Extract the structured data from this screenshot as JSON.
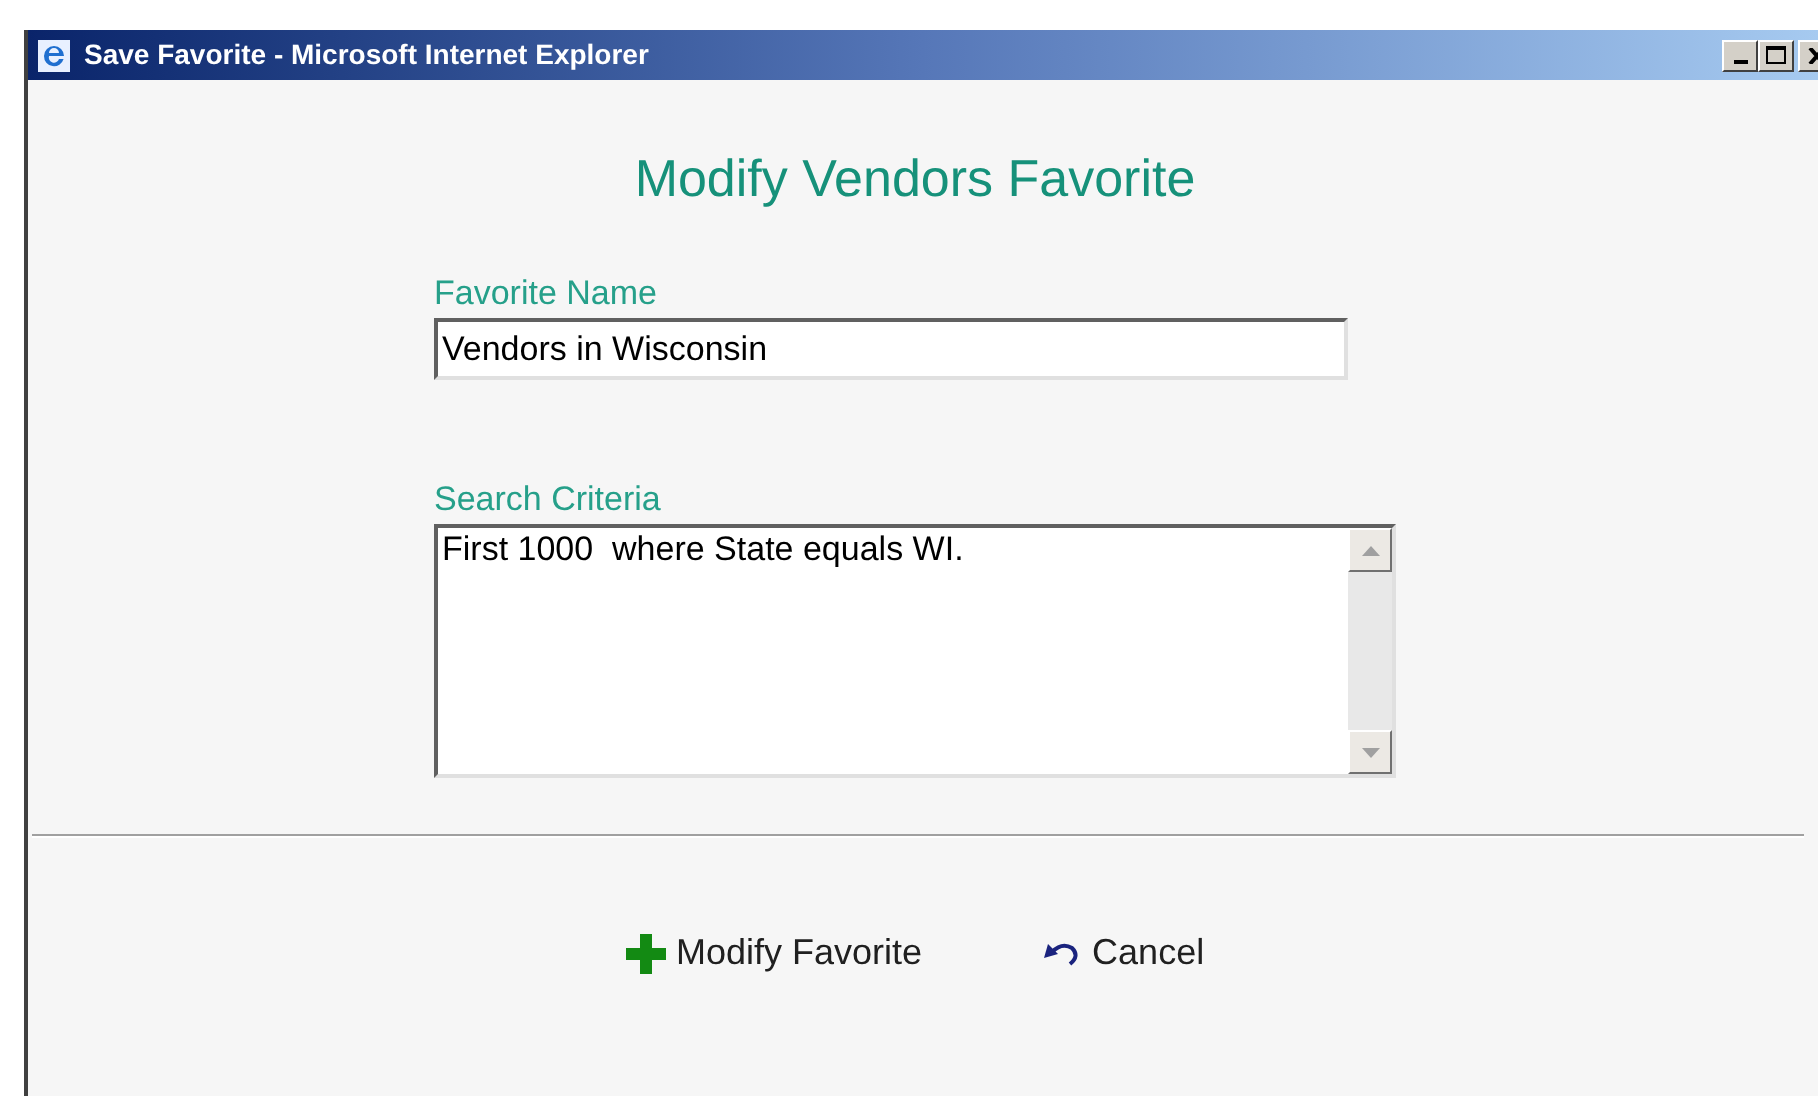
{
  "window": {
    "title": "Save Favorite - Microsoft Internet Explorer"
  },
  "heading": "Modify Vendors Favorite",
  "favorite_name": {
    "label": "Favorite Name",
    "value": "Vendors in Wisconsin"
  },
  "search_criteria": {
    "label": "Search Criteria",
    "value": "First 1000  where State equals WI."
  },
  "buttons": [
    {
      "kind": "add",
      "label": "Modify Favorite"
    },
    {
      "kind": "undo",
      "label": "Cancel"
    }
  ]
}
